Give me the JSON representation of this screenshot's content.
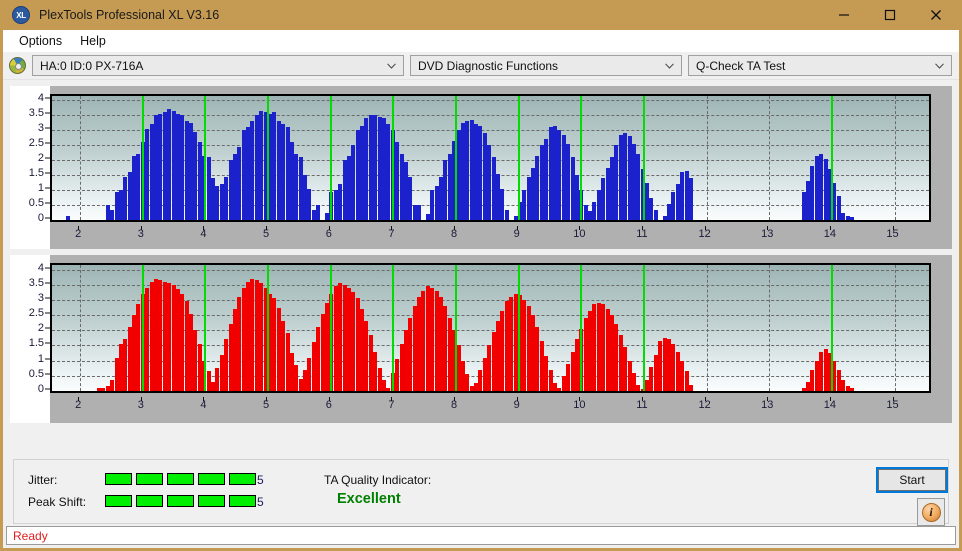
{
  "window": {
    "title": "PlexTools Professional XL V3.16",
    "app_icon": "xl-logo-icon",
    "minimize_label": "minimize-icon",
    "maximize_label": "maximize-icon",
    "close_label": "close-icon",
    "titlebar_color": "#c59a53"
  },
  "menu": {
    "items": [
      {
        "label": "Options"
      },
      {
        "label": "Help"
      }
    ]
  },
  "toolbar": {
    "drive_icon": "disc-icon",
    "drive": "HA:0 ID:0  PX-716A",
    "function": "DVD Diagnostic Functions",
    "test": "Q-Check TA Test"
  },
  "charts": [
    {
      "name": "ta-test-chart-top",
      "color": "#1b22cc",
      "marker_color": "#00dd00",
      "y_ticks": [
        "4",
        "3.5",
        "3",
        "2.5",
        "2",
        "1.5",
        "1",
        "0.5",
        "0"
      ],
      "x_ticks": [
        "2",
        "3",
        "4",
        "5",
        "6",
        "7",
        "8",
        "9",
        "10",
        "11",
        "12",
        "13",
        "14",
        "15"
      ]
    },
    {
      "name": "ta-test-chart-bottom",
      "color": "#f20000",
      "marker_color": "#00dd00",
      "y_ticks": [
        "4",
        "3.5",
        "3",
        "2.5",
        "2",
        "1.5",
        "1",
        "0.5",
        "0"
      ],
      "x_ticks": [
        "2",
        "3",
        "4",
        "5",
        "6",
        "7",
        "8",
        "9",
        "10",
        "11",
        "12",
        "13",
        "14",
        "15"
      ]
    }
  ],
  "chart_data": [
    {
      "type": "bar",
      "title": "",
      "series_name": "Jitter",
      "color": "#1b22cc",
      "xlabel": "",
      "ylabel": "",
      "xlim": [
        1.55,
        15.55
      ],
      "ylim": [
        0,
        4.15
      ],
      "ytick_values": [
        0,
        0.5,
        1,
        1.5,
        2,
        2.5,
        3,
        3.5,
        4
      ],
      "xtick_values": [
        2,
        3,
        4,
        5,
        6,
        7,
        8,
        9,
        10,
        11,
        12,
        13,
        14,
        15
      ],
      "grid": true,
      "markers_x": [
        3,
        4,
        5,
        6,
        7,
        8,
        9,
        10,
        11,
        14
      ],
      "x": [
        1.6,
        1.67,
        1.74,
        1.81,
        1.88,
        1.95,
        2.02,
        2.09,
        2.16,
        2.23,
        2.3,
        2.37,
        2.44,
        2.51,
        2.58,
        2.65,
        2.72,
        2.79,
        2.86,
        2.93,
        3.0,
        3.07,
        3.14,
        3.21,
        3.28,
        3.35,
        3.42,
        3.49,
        3.56,
        3.63,
        3.7,
        3.77,
        3.84,
        3.91,
        3.98,
        4.05,
        4.12,
        4.19,
        4.26,
        4.33,
        4.4,
        4.47,
        4.54,
        4.61,
        4.68,
        4.75,
        4.82,
        4.89,
        4.96,
        5.03,
        5.1,
        5.17,
        5.24,
        5.31,
        5.38,
        5.45,
        5.52,
        5.59,
        5.66,
        5.73,
        5.8,
        5.87,
        5.94,
        6.01,
        6.08,
        6.15,
        6.22,
        6.29,
        6.36,
        6.43,
        6.5,
        6.57,
        6.64,
        6.71,
        6.78,
        6.85,
        6.92,
        6.99,
        7.06,
        7.13,
        7.2,
        7.27,
        7.34,
        7.41,
        7.48,
        7.55,
        7.62,
        7.69,
        7.76,
        7.83,
        7.9,
        7.97,
        8.04,
        8.11,
        8.18,
        8.25,
        8.32,
        8.39,
        8.46,
        8.53,
        8.6,
        8.67,
        8.74,
        8.81,
        8.88,
        8.95,
        9.02,
        9.09,
        9.16,
        9.23,
        9.3,
        9.37,
        9.44,
        9.51,
        9.58,
        9.65,
        9.72,
        9.79,
        9.86,
        9.93,
        10.0,
        10.07,
        10.14,
        10.21,
        10.28,
        10.35,
        10.42,
        10.49,
        10.56,
        10.63,
        10.7,
        10.77,
        10.84,
        10.91,
        10.98,
        11.05,
        11.12,
        11.19,
        11.26,
        11.33,
        11.4,
        11.47,
        11.54,
        11.61,
        11.68,
        11.75,
        13.55,
        13.62,
        13.69,
        13.76,
        13.83,
        13.9,
        13.97,
        14.04,
        14.11,
        14.18,
        14.25,
        14.32
      ],
      "y": [
        0,
        0,
        0,
        0.15,
        0,
        0,
        0,
        0,
        0,
        0,
        0,
        0,
        0.5,
        0.35,
        0.95,
        1,
        1.45,
        1.6,
        2.15,
        2.2,
        2.6,
        3.05,
        3.2,
        3.5,
        3.55,
        3.6,
        3.7,
        3.65,
        3.55,
        3.5,
        3.3,
        3.25,
        2.95,
        2.6,
        2.15,
        2.1,
        1.4,
        1.15,
        1.2,
        1.45,
        2.0,
        2.2,
        2.45,
        3.0,
        3.1,
        3.3,
        3.5,
        3.65,
        3.6,
        3.55,
        3.6,
        3.3,
        3.2,
        3.1,
        2.6,
        2.2,
        2.1,
        1.5,
        1.05,
        0.35,
        0.5,
        0,
        0.25,
        0.95,
        1,
        1.2,
        2.0,
        2.15,
        2.5,
        3.0,
        3.15,
        3.4,
        3.5,
        3.5,
        3.45,
        3.4,
        3.2,
        3.0,
        2.6,
        2.2,
        1.95,
        1.45,
        0.5,
        0.5,
        0,
        0.2,
        1.0,
        1.15,
        1.45,
        2.0,
        2.2,
        2.65,
        3.0,
        3.25,
        3.3,
        3.35,
        3.2,
        3.15,
        2.9,
        2.5,
        2.1,
        1.55,
        1.05,
        0.35,
        0,
        0.15,
        0.6,
        1.0,
        1.45,
        1.75,
        2.15,
        2.5,
        2.7,
        3.1,
        3.15,
        3.0,
        2.85,
        2.55,
        2.1,
        1.5,
        1.0,
        0.5,
        0.3,
        0.6,
        1.0,
        1.4,
        1.75,
        2.1,
        2.5,
        2.85,
        2.9,
        2.8,
        2.55,
        2.2,
        1.7,
        1.25,
        0.75,
        0.35,
        0,
        0.15,
        0.55,
        0.95,
        1.2,
        1.6,
        1.65,
        1.4,
        0.95,
        1.3,
        1.8,
        2.15,
        2.2,
        2.05,
        1.7,
        1.25,
        0.8,
        0.25,
        0.15,
        0.1
      ]
    },
    {
      "type": "bar",
      "title": "",
      "series_name": "Peak Shift",
      "color": "#f20000",
      "xlabel": "",
      "ylabel": "",
      "xlim": [
        1.55,
        15.55
      ],
      "ylim": [
        0,
        4.15
      ],
      "ytick_values": [
        0,
        0.5,
        1,
        1.5,
        2,
        2.5,
        3,
        3.5,
        4
      ],
      "xtick_values": [
        2,
        3,
        4,
        5,
        6,
        7,
        8,
        9,
        10,
        11,
        12,
        13,
        14,
        15
      ],
      "grid": true,
      "markers_x": [
        3,
        4,
        5,
        6,
        7,
        8,
        9,
        10,
        11,
        14
      ],
      "x": [
        1.6,
        1.67,
        1.74,
        1.81,
        1.88,
        1.95,
        2.02,
        2.09,
        2.16,
        2.23,
        2.3,
        2.37,
        2.44,
        2.51,
        2.58,
        2.65,
        2.72,
        2.79,
        2.86,
        2.93,
        3.0,
        3.07,
        3.14,
        3.21,
        3.28,
        3.35,
        3.42,
        3.49,
        3.56,
        3.63,
        3.7,
        3.77,
        3.84,
        3.91,
        3.98,
        4.05,
        4.12,
        4.19,
        4.26,
        4.33,
        4.4,
        4.47,
        4.54,
        4.61,
        4.68,
        4.75,
        4.82,
        4.89,
        4.96,
        5.03,
        5.1,
        5.17,
        5.24,
        5.31,
        5.38,
        5.45,
        5.52,
        5.59,
        5.66,
        5.73,
        5.8,
        5.87,
        5.94,
        6.01,
        6.08,
        6.15,
        6.22,
        6.29,
        6.36,
        6.43,
        6.5,
        6.57,
        6.64,
        6.71,
        6.78,
        6.85,
        6.92,
        6.99,
        7.06,
        7.13,
        7.2,
        7.27,
        7.34,
        7.41,
        7.48,
        7.55,
        7.62,
        7.69,
        7.76,
        7.83,
        7.9,
        7.97,
        8.04,
        8.11,
        8.18,
        8.25,
        8.32,
        8.39,
        8.46,
        8.53,
        8.6,
        8.67,
        8.74,
        8.81,
        8.88,
        8.95,
        9.02,
        9.09,
        9.16,
        9.23,
        9.3,
        9.37,
        9.44,
        9.51,
        9.58,
        9.65,
        9.72,
        9.79,
        9.86,
        9.93,
        10.0,
        10.07,
        10.14,
        10.21,
        10.28,
        10.35,
        10.42,
        10.49,
        10.56,
        10.63,
        10.7,
        10.77,
        10.84,
        10.91,
        10.98,
        11.05,
        11.12,
        11.19,
        11.26,
        11.33,
        11.4,
        11.47,
        11.54,
        11.61,
        11.68,
        11.75,
        13.55,
        13.62,
        13.69,
        13.76,
        13.83,
        13.9,
        13.97,
        14.04,
        14.11,
        14.18,
        14.25,
        14.32
      ],
      "y": [
        0,
        0,
        0,
        0,
        0,
        0,
        0,
        0,
        0,
        0,
        0.1,
        0.1,
        0.15,
        0.35,
        1.1,
        1.55,
        1.7,
        2.1,
        2.5,
        2.85,
        3.2,
        3.4,
        3.6,
        3.7,
        3.65,
        3.6,
        3.55,
        3.5,
        3.35,
        3.2,
        2.95,
        2.55,
        2.0,
        1.55,
        1.0,
        0.65,
        0.3,
        0.75,
        1.2,
        1.7,
        2.2,
        2.7,
        3.1,
        3.4,
        3.6,
        3.7,
        3.65,
        3.55,
        3.4,
        3.2,
        3.05,
        2.75,
        2.3,
        1.9,
        1.25,
        0.85,
        0.4,
        0.7,
        1.1,
        1.6,
        2.1,
        2.55,
        2.9,
        3.2,
        3.45,
        3.55,
        3.5,
        3.4,
        3.25,
        3.05,
        2.7,
        2.3,
        1.85,
        1.3,
        0.75,
        0.35,
        0.1,
        0.6,
        1.05,
        1.55,
        2.0,
        2.4,
        2.8,
        3.1,
        3.3,
        3.45,
        3.4,
        3.3,
        3.1,
        2.8,
        2.4,
        2.0,
        1.5,
        1.0,
        0.55,
        0.15,
        0.25,
        0.7,
        1.1,
        1.5,
        1.95,
        2.3,
        2.65,
        2.95,
        3.1,
        3.2,
        3.15,
        3.0,
        2.8,
        2.5,
        2.1,
        1.65,
        1.15,
        0.7,
        0.25,
        0.1,
        0.5,
        0.9,
        1.3,
        1.7,
        2.05,
        2.4,
        2.65,
        2.85,
        2.9,
        2.85,
        2.7,
        2.5,
        2.2,
        1.85,
        1.45,
        1.0,
        0.6,
        0.2,
        0.05,
        0.35,
        0.8,
        1.2,
        1.65,
        1.75,
        1.7,
        1.55,
        1.3,
        1.0,
        0.65,
        0.2,
        0.1,
        0.3,
        0.7,
        1.0,
        1.3,
        1.4,
        1.25,
        1.0,
        0.7,
        0.35,
        0.15,
        0.1
      ]
    }
  ],
  "indicators": {
    "jitter_label": "Jitter:",
    "jitter_segments": 5,
    "jitter_value": "5",
    "peak_shift_label": "Peak Shift:",
    "peak_shift_segments": 5,
    "peak_shift_value": "5",
    "segment_color": "#00ee00",
    "ta_quality_label": "TA Quality Indicator:",
    "ta_quality_value": "Excellent",
    "ta_quality_color": "#008000"
  },
  "actions": {
    "start_label": "Start",
    "info_label": "i"
  },
  "status": {
    "text": "Ready",
    "color": "#e02020"
  }
}
